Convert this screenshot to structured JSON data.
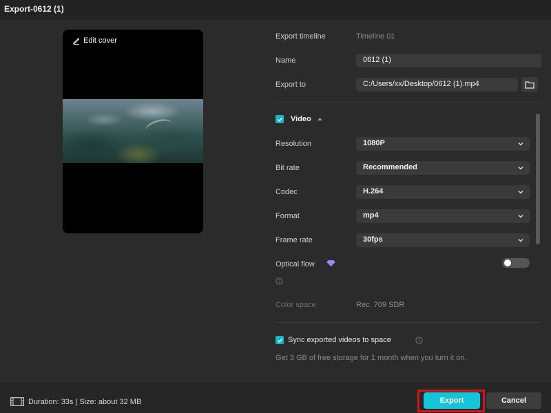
{
  "window": {
    "title": "Export-0612 (1)"
  },
  "preview": {
    "edit_cover_label": "Edit cover"
  },
  "export": {
    "timeline_label": "Export timeline",
    "timeline_value": "Timeline 01",
    "name_label": "Name",
    "name_value": "0612 (1)",
    "export_to_label": "Export to",
    "export_to_value": "C:/Users/xx/Desktop/0612 (1).mp4"
  },
  "video": {
    "section_label": "Video",
    "checked": true,
    "resolution_label": "Resolution",
    "resolution_value": "1080P",
    "bitrate_label": "Bit rate",
    "bitrate_value": "Recommended",
    "codec_label": "Codec",
    "codec_value": "H.264",
    "format_label": "Format",
    "format_value": "mp4",
    "framerate_label": "Frame rate",
    "framerate_value": "30fps",
    "optical_flow_label": "Optical flow",
    "optical_flow_enabled": false,
    "color_space_label": "Color space",
    "color_space_value": "Rec. 709 SDR"
  },
  "sync": {
    "label": "Sync exported videos to space",
    "checked": true,
    "hint": "Get 3 GB of free storage for 1 month when you turn it on."
  },
  "footer": {
    "info": "Duration: 33s | Size: about 32 MB",
    "export_label": "Export",
    "cancel_label": "Cancel"
  },
  "colors": {
    "accent": "#16c4d9",
    "highlight_frame": "#d3141a",
    "premium": "#9b7bf5"
  }
}
